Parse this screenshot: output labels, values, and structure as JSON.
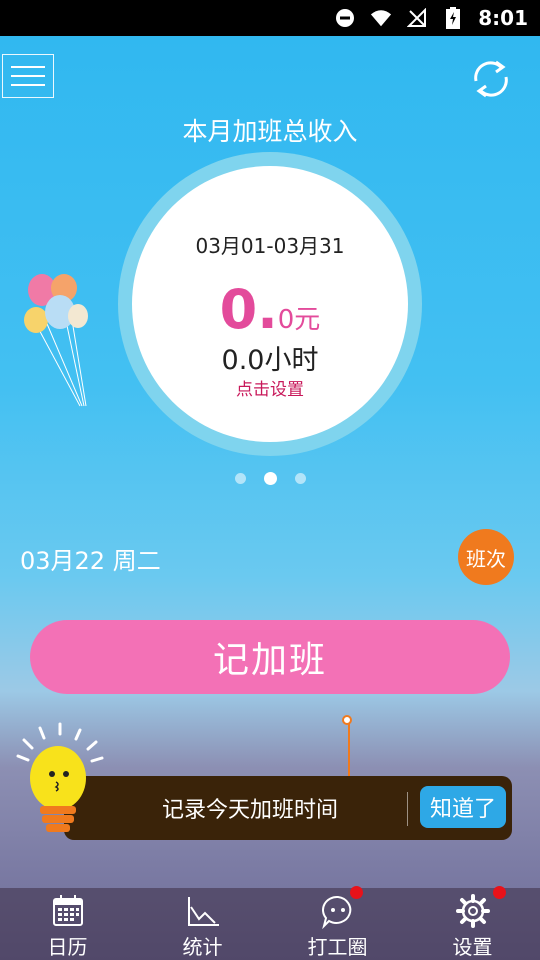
{
  "status_bar": {
    "time": "8:01",
    "icons": [
      "do-not-disturb-icon",
      "wifi-icon",
      "no-signal-icon",
      "battery-charging-icon"
    ]
  },
  "header": {
    "menu_icon": "hamburger-menu-icon",
    "refresh_icon": "refresh-icon"
  },
  "summary": {
    "title": "本月加班总收入",
    "date_range": "03月01-03月31",
    "amount_int": "0",
    "amount_dot": ".",
    "amount_dec": "0元",
    "hours": "0.0小时",
    "set_link": "点击设置"
  },
  "pager": {
    "count": 3,
    "active_index": 1
  },
  "day": {
    "date": "03月22 周二",
    "shift_label": "班次"
  },
  "record_button": "记加班",
  "tip": {
    "text": "记录今天加班时间",
    "button": "知道了"
  },
  "tabs": [
    {
      "label": "日历",
      "icon": "calendar-icon",
      "badge": false
    },
    {
      "label": "统计",
      "icon": "chart-icon",
      "badge": false
    },
    {
      "label": "打工圈",
      "icon": "chat-bubble-icon",
      "badge": true
    },
    {
      "label": "设置",
      "icon": "gear-icon",
      "badge": true
    }
  ],
  "colors": {
    "accent_pink": "#F371B6",
    "amount_pink": "#E34B9B",
    "orange": "#F07A1E",
    "badge_red": "#E8121A",
    "tip_button_blue": "#2EA8E6"
  }
}
